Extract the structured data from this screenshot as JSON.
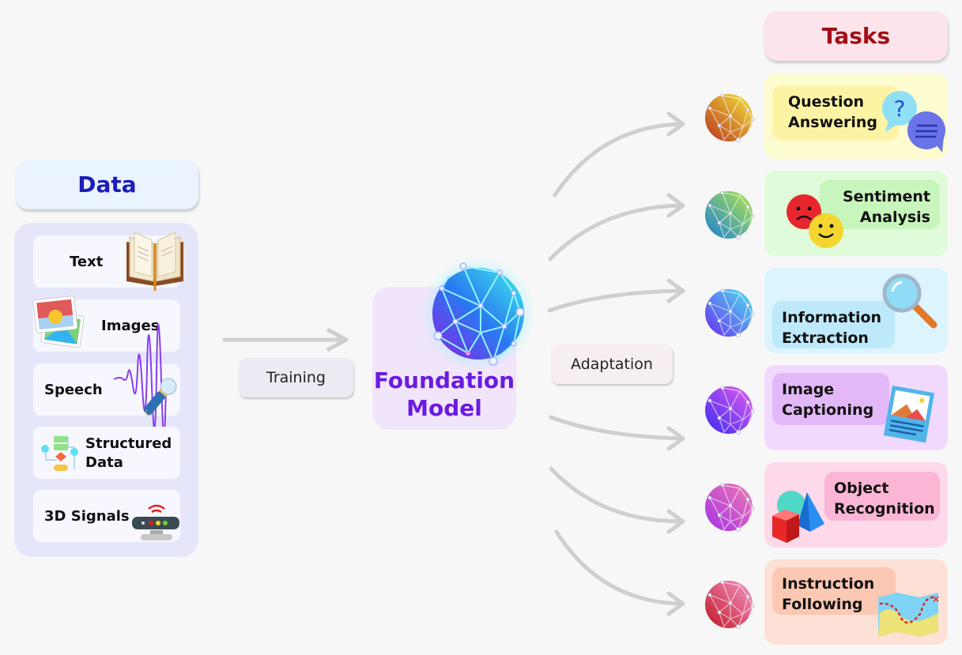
{
  "data_section": {
    "title": "Data",
    "items": [
      {
        "label": "Text",
        "icon": "open-book-icon"
      },
      {
        "label": "Images",
        "icon": "photo-gallery-icon"
      },
      {
        "label": "Speech",
        "icon": "microphone-soundwave-icon"
      },
      {
        "label": "Structured Data",
        "label_line1": "Structured",
        "label_line2": "Data",
        "icon": "flowchart-icon"
      },
      {
        "label": "3D Signals",
        "icon": "sensor-device-icon"
      }
    ]
  },
  "training_label": "Training",
  "foundation_model": {
    "line1": "Foundation",
    "line2": "Model",
    "icon": "neural-network-globe-icon"
  },
  "adaptation_label": "Adaptation",
  "tasks_section": {
    "title": "Tasks",
    "items": [
      {
        "line1": "Question",
        "line2": "Answering",
        "icon": "chat-bubbles-icon",
        "bg": "#fdfbd0",
        "inner": "#fcf4a4",
        "globe": [
          "#f4e73c",
          "#b8331e"
        ]
      },
      {
        "line1": "Sentiment",
        "line2": "Analysis",
        "icon": "emoji-faces-icon",
        "bg": "#e0fbd9",
        "inner": "#c8f5bc",
        "globe": [
          "#b4e84a",
          "#1a7fd6"
        ]
      },
      {
        "line1": "Information",
        "line2": "Extraction",
        "icon": "magnifier-icon",
        "bg": "#dbf4fe",
        "inner": "#bde9fb",
        "globe": [
          "#4de3ef",
          "#6a2cf0"
        ]
      },
      {
        "line1": "Image",
        "line2": "Captioning",
        "icon": "image-document-icon",
        "bg": "#f1d9fd",
        "inner": "#e3b8f8",
        "globe": [
          "#e35bf0",
          "#3a2cf0"
        ]
      },
      {
        "line1": "Object",
        "line2": "Recognition",
        "icon": "3d-shapes-icon",
        "bg": "#fdd9ea",
        "inner": "#fbb6d6",
        "globe": [
          "#f07ab0",
          "#a432e8"
        ]
      },
      {
        "line1": "Instruction",
        "line2": "Following",
        "icon": "treasure-map-icon",
        "bg": "#fde1d6",
        "inner": "#fbc8b4",
        "globe": [
          "#f596c8",
          "#c01624"
        ]
      }
    ]
  }
}
